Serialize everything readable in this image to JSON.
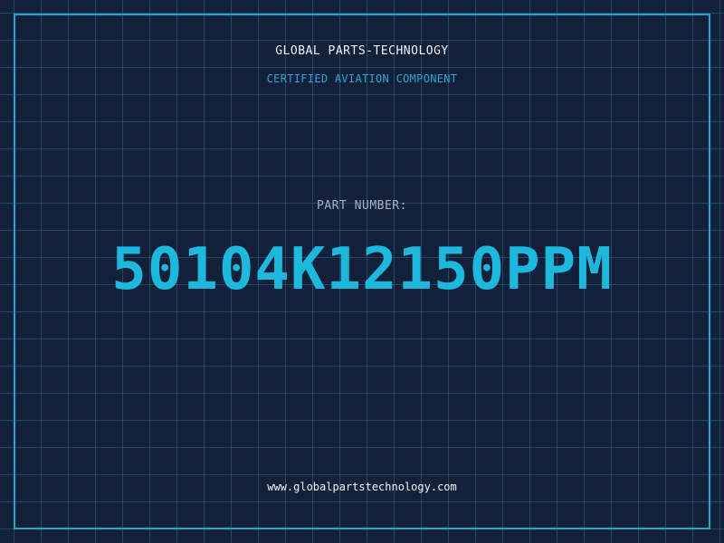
{
  "header": {
    "company": "GLOBAL PARTS-TECHNOLOGY",
    "subtitle": "CERTIFIED AVIATION COMPONENT"
  },
  "part": {
    "label": "PART NUMBER:",
    "number": "50104K12150PPM"
  },
  "footer": {
    "website": "www.globalpartstechnology.com"
  },
  "colors": {
    "background": "#13203a",
    "grid": "#2d8caf",
    "frame": "#1aa7d0",
    "part_number": "#1db8dd",
    "subtitle": "#2aa6d2",
    "label": "#a7b1c0",
    "text": "#f2f4f7"
  }
}
